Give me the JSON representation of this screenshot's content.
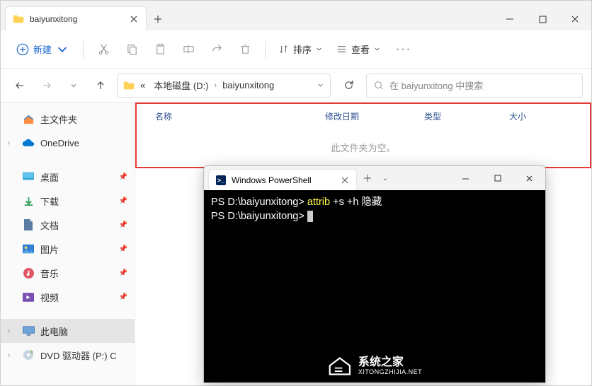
{
  "window": {
    "tab_title": "baiyunxitong"
  },
  "toolbar": {
    "new_label": "新建",
    "sort_label": "排序",
    "view_label": "查看"
  },
  "breadcrumb": {
    "root_glyph": "«",
    "disk": "本地磁盘 (D:)",
    "folder": "baiyunxitong"
  },
  "search": {
    "placeholder": "在 baiyunxitong 中搜索"
  },
  "sidebar": {
    "home": "主文件夹",
    "onedrive": "OneDrive",
    "quick": [
      {
        "label": "桌面"
      },
      {
        "label": "下载"
      },
      {
        "label": "文档"
      },
      {
        "label": "图片"
      },
      {
        "label": "音乐"
      },
      {
        "label": "视频"
      }
    ],
    "thispc": "此电脑",
    "dvd": "DVD 驱动器 (P:) C"
  },
  "columns": {
    "name": "名称",
    "date": "修改日期",
    "type": "类型",
    "size": "大小"
  },
  "content": {
    "empty_text": "此文件夹为空。"
  },
  "powershell": {
    "tab_title": "Windows PowerShell",
    "lines": [
      {
        "prompt": "PS D:\\baiyunxitong> ",
        "cmd": "attrib",
        "rest": " +s +h 隐藏"
      },
      {
        "prompt": "PS D:\\baiyunxitong> ",
        "cmd": "",
        "rest": ""
      }
    ],
    "watermark_main": "系统之家",
    "watermark_sub": "XITONGZHIJIA.NET"
  }
}
